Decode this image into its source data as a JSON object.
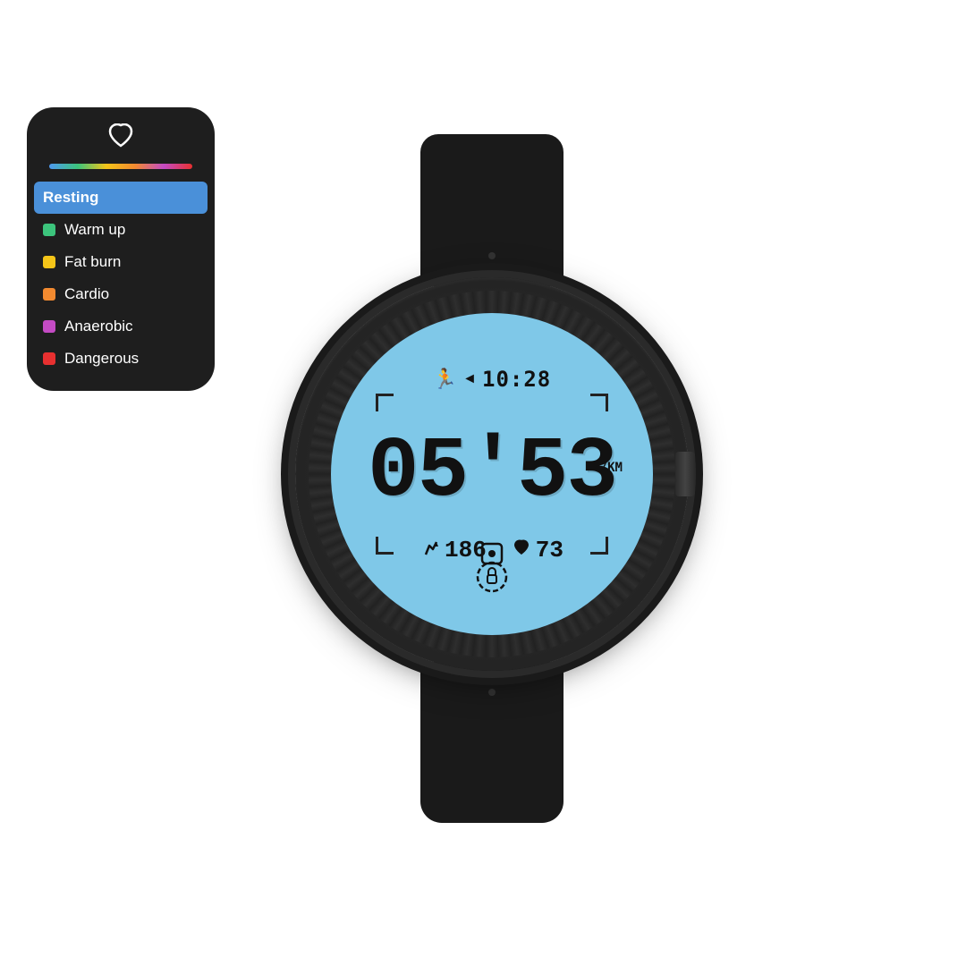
{
  "legend": {
    "icon": "♥",
    "color_bar": true,
    "items": [
      {
        "id": "resting",
        "label": "Resting",
        "color": "#4a90d9",
        "active": true
      },
      {
        "id": "warm_up",
        "label": "Warm up",
        "color": "#3cc47c",
        "active": false
      },
      {
        "id": "fat_burn",
        "label": "Fat burn",
        "color": "#f5c518",
        "active": false
      },
      {
        "id": "cardio",
        "label": "Cardio",
        "color": "#f28a30",
        "active": false
      },
      {
        "id": "anaerobic",
        "label": "Anaerobic",
        "color": "#c44bc4",
        "active": false
      },
      {
        "id": "dangerous",
        "label": "Dangerous",
        "color": "#e83030",
        "active": false
      }
    ]
  },
  "watch": {
    "face": {
      "background_color": "#7fc8e8",
      "top_time": "10:28",
      "main_time": "05'53",
      "unit": "/KM",
      "steps": "186",
      "heart_rate": "73",
      "run_icon": "🏃",
      "arrow_icon": "◄",
      "timer_icon": "⏱",
      "heart_icon": "♥",
      "steps_icon": "👟",
      "lock_icon": "🔒"
    }
  }
}
